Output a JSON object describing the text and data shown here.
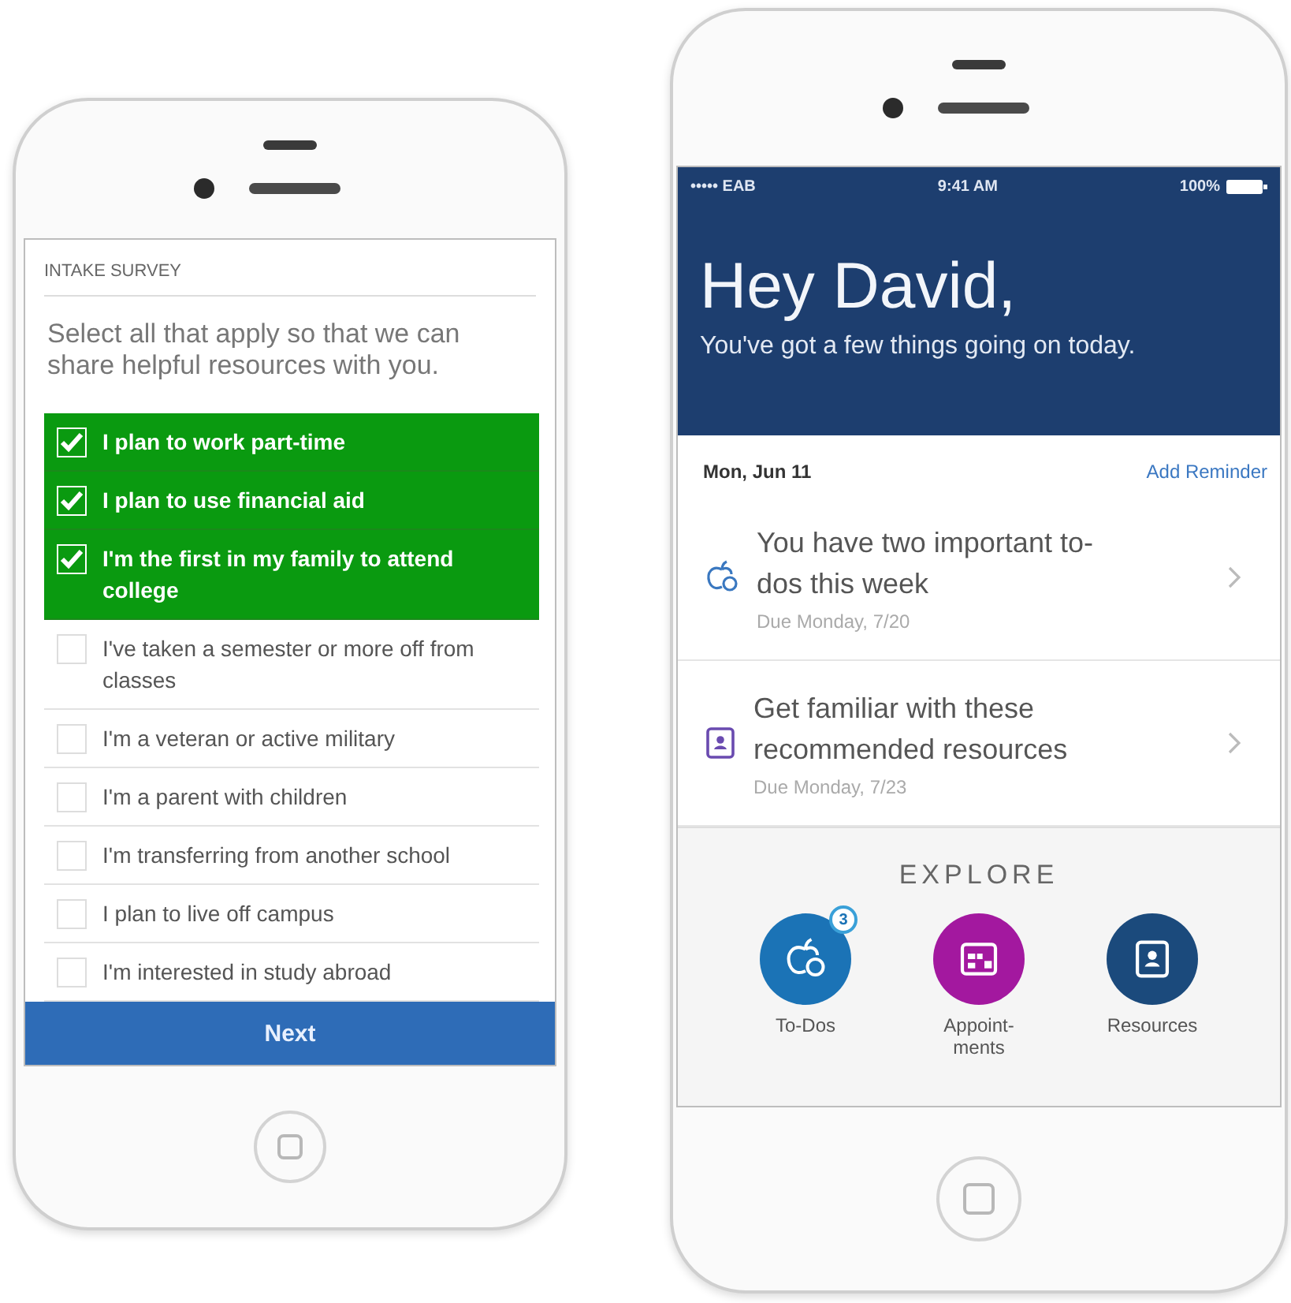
{
  "survey_phone": {
    "title": "INTAKE SURVEY",
    "prompt": "Select all that apply so that we can share helpful resources with you.",
    "options": [
      {
        "label": "I plan to work part-time",
        "checked": true
      },
      {
        "label": "I plan to use financial aid",
        "checked": true
      },
      {
        "label": "I'm the first in my family to attend college",
        "checked": true
      },
      {
        "label": "I've taken a semester or more off from classes",
        "checked": false
      },
      {
        "label": "I'm a veteran or active military",
        "checked": false
      },
      {
        "label": "I'm a parent with children",
        "checked": false
      },
      {
        "label": "I'm transferring from another school",
        "checked": false
      },
      {
        "label": "I plan to live off campus",
        "checked": false
      },
      {
        "label": "I'm interested in study abroad",
        "checked": false
      }
    ],
    "next_button": "Next"
  },
  "home_phone": {
    "status_bar": {
      "carrier": "••••• EAB",
      "time": "9:41 AM",
      "battery": "100%"
    },
    "greeting": "Hey David,",
    "subtitle": "You've got a few things going on today.",
    "date": "Mon, Jun 11",
    "add_reminder": "Add Reminder",
    "tasks": [
      {
        "kind": "todo",
        "title": "You have two important to-dos this week",
        "due": "Due Monday, 7/20"
      },
      {
        "kind": "resource",
        "title": "Get familiar with these recommended resources",
        "due": "Due Monday, 7/23"
      }
    ],
    "explore": {
      "heading": "EXPLORE",
      "items": [
        {
          "kind": "todo",
          "label": "To-Dos",
          "badge": "3",
          "color": "#1b73b6"
        },
        {
          "kind": "calendar",
          "label": "Appoint-ments",
          "color": "#a3189f"
        },
        {
          "kind": "resource",
          "label": "Resources",
          "color": "#1b4a7c"
        }
      ]
    }
  }
}
